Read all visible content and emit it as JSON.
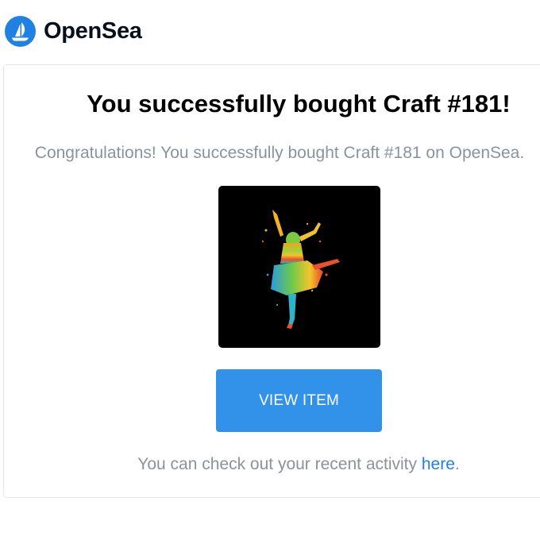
{
  "header": {
    "brand": "OpenSea",
    "logo_icon": "opensea-boat-icon",
    "logo_color": "#2081E2"
  },
  "email": {
    "title": "You successfully bought Craft #181!",
    "subtitle": "Congratulations! You successfully bought Craft #181 on OpenSea.",
    "button_label": "VIEW ITEM",
    "footer_prefix": "You can check out your recent activity ",
    "footer_link": "here",
    "footer_suffix": "."
  },
  "colors": {
    "button": "#3291e9",
    "muted_text": "#8a939b",
    "link": "#2081E2"
  }
}
